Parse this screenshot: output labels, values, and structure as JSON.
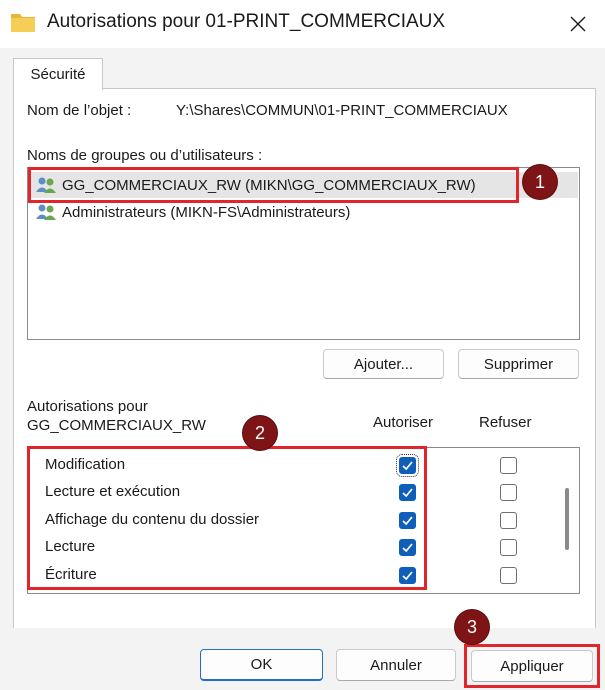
{
  "window": {
    "title": "Autorisations pour 01-PRINT_COMMERCIAUX",
    "folder_icon": "folder-icon",
    "close_icon": "close-icon"
  },
  "tabs": [
    {
      "label": "Sécurité",
      "active": true
    }
  ],
  "object": {
    "label": "Nom de l’objet :",
    "value": "Y:\\Shares\\COMMUN\\01-PRINT_COMMERCIAUX"
  },
  "groups": {
    "label": "Noms de groupes ou d’utilisateurs :",
    "items": [
      {
        "name": "GG_COMMERCIAUX_RW (MIKN\\GG_COMMERCIAUX_RW)",
        "selected": true,
        "icon": "users-icon"
      },
      {
        "name": "Administrateurs (MIKN-FS\\Administrateurs)",
        "selected": false,
        "icon": "users-icon"
      }
    ],
    "add_label": "Ajouter...",
    "remove_label": "Supprimer"
  },
  "permissions": {
    "label_line1": "Autorisations pour",
    "label_line2": "GG_COMMERCIAUX_RW",
    "allow_header": "Autoriser",
    "deny_header": "Refuser",
    "rows": [
      {
        "name": "Modification",
        "allow": true,
        "deny": false
      },
      {
        "name": "Lecture et exécution",
        "allow": true,
        "deny": false
      },
      {
        "name": "Affichage du contenu du dossier",
        "allow": true,
        "deny": false
      },
      {
        "name": "Lecture",
        "allow": true,
        "deny": false
      },
      {
        "name": "Écriture",
        "allow": true,
        "deny": false
      }
    ]
  },
  "footer": {
    "ok_label": "OK",
    "cancel_label": "Annuler",
    "apply_label": "Appliquer"
  },
  "annotations": {
    "badge_1": "1",
    "badge_2": "2",
    "badge_3": "3",
    "highlight_color": "#e0262a",
    "badge_color": "#7f1416"
  },
  "colors": {
    "checkbox_checked": "#0f5fb8",
    "primary_button_border": "#1e6fc8"
  }
}
